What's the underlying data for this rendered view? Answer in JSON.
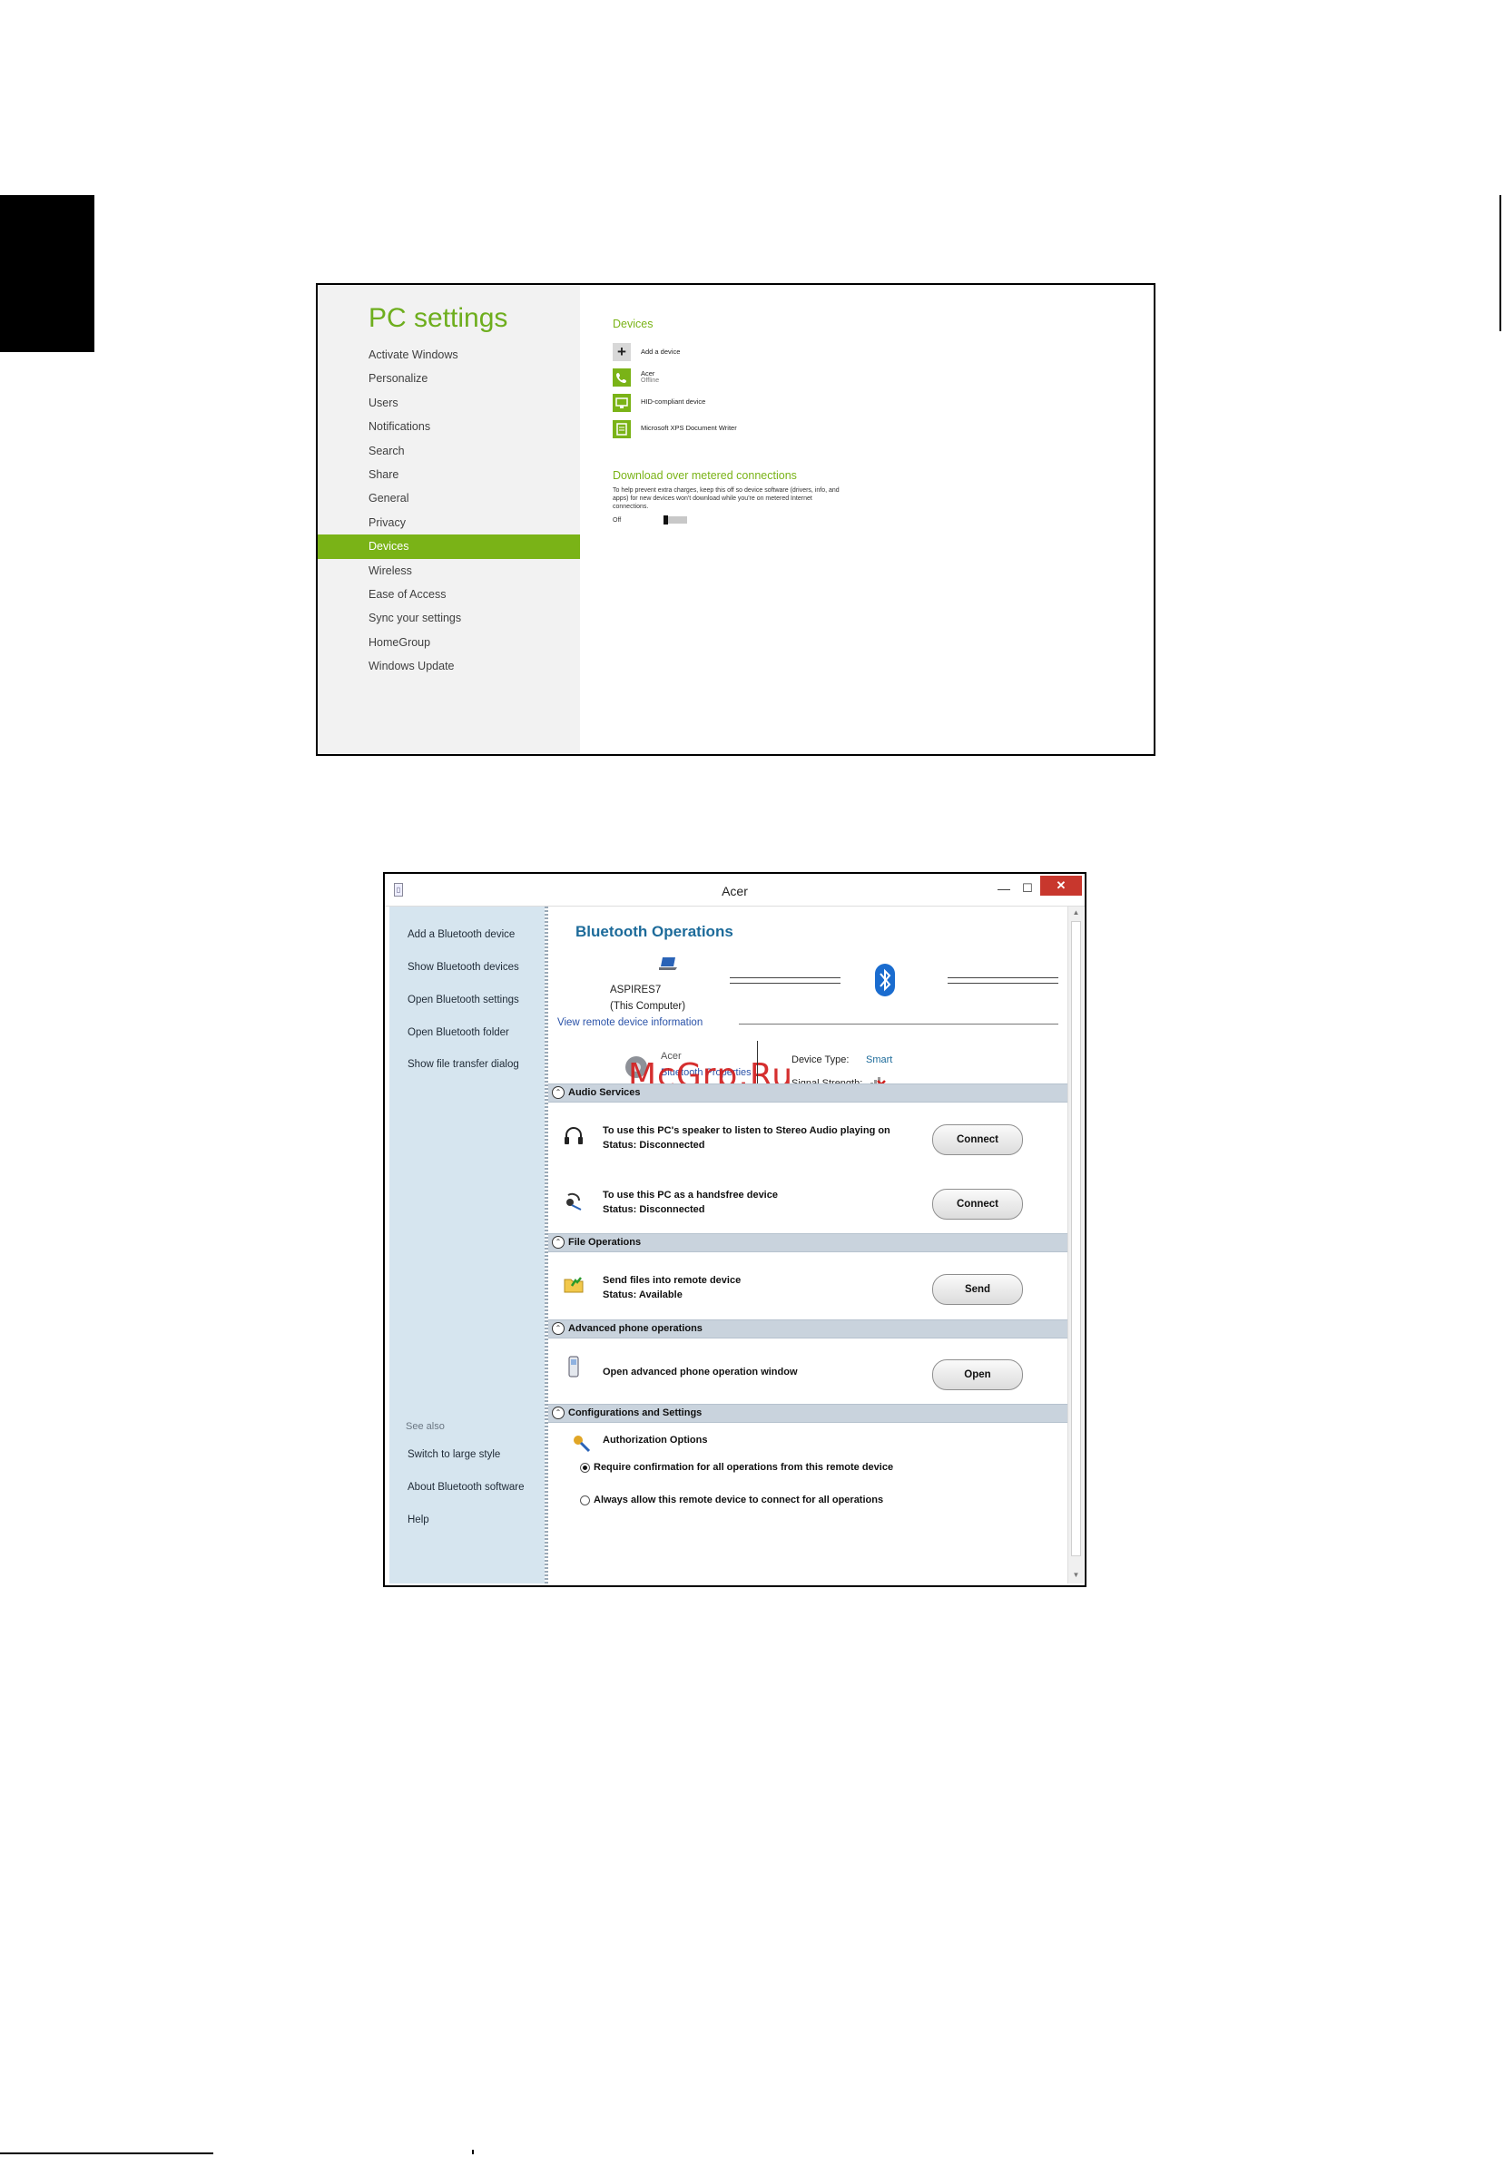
{
  "pc_settings": {
    "title": "PC settings",
    "nav": [
      "Activate Windows",
      "Personalize",
      "Users",
      "Notifications",
      "Search",
      "Share",
      "General",
      "Privacy",
      "Devices",
      "Wireless",
      "Ease of Access",
      "Sync your settings",
      "HomeGroup",
      "Windows Update"
    ],
    "active_index": 8,
    "devices_heading": "Devices",
    "add_device": "Add a device",
    "devices": [
      {
        "name": "Acer",
        "status": "Offline",
        "icon": "phone-icon"
      },
      {
        "name": "HID-compliant device",
        "status": "",
        "icon": "hid-device-icon"
      },
      {
        "name": "Microsoft XPS Document Writer",
        "status": "",
        "icon": "printer-icon"
      }
    ],
    "metered_heading": "Download over metered connections",
    "metered_desc": "To help prevent extra charges, keep this off so device software (drivers, info, and apps) for new devices won't download while you're on metered Internet connections.",
    "toggle_label": "Off",
    "accent": "#7ab317"
  },
  "bluetooth": {
    "window_title": "Acer",
    "sidebar": [
      "Add a Bluetooth device",
      "Show Bluetooth devices",
      "Open Bluetooth settings",
      "Open Bluetooth folder",
      "Show file transfer dialog"
    ],
    "see_also_label": "See also",
    "see_also": [
      "Switch to large style",
      "About Bluetooth software",
      "Help"
    ],
    "heading": "Bluetooth Operations",
    "computer_name": "ASPIRES7",
    "computer_sub": "(This Computer)",
    "view_remote": "View remote device information",
    "remote_name": "Acer",
    "remote_link": "Bluetooth Properties",
    "device_type_label": "Device Type:",
    "device_type_value": "Smart",
    "signal_label": "Signal Strength:",
    "watermark": "McGrp.Ru",
    "sections": {
      "audio": "Audio Services",
      "file": "File Operations",
      "phone": "Advanced phone operations",
      "config": "Configurations and Settings"
    },
    "audio_rows": [
      {
        "text": "To use this PC's speaker to listen to Stereo Audio playing on",
        "status": "Status:   Disconnected",
        "button": "Connect"
      },
      {
        "text": "To use this PC as a handsfree device",
        "status": "Status:   Disconnected",
        "button": "Connect"
      }
    ],
    "file_row": {
      "text": "Send files into remote device",
      "status": "Status:   Available",
      "button": "Send"
    },
    "phone_row": {
      "text": "Open advanced phone operation window",
      "button": "Open"
    },
    "auth_title": "Authorization Options",
    "auth_options": [
      "Require confirmation for all operations from this remote device",
      "Always allow this remote device to connect for all operations"
    ],
    "auth_selected": 0,
    "accent": "#1d6b9a"
  }
}
